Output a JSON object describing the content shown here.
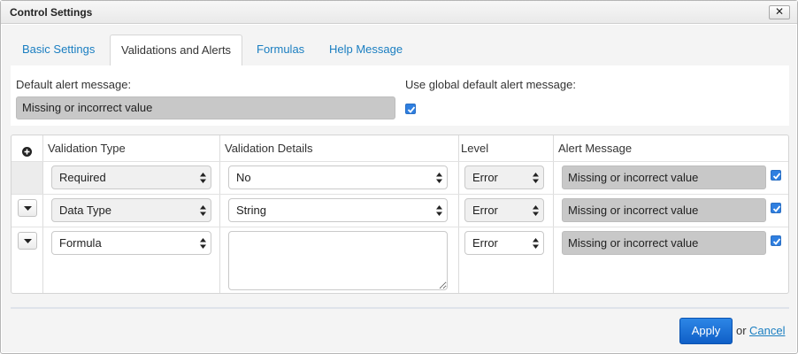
{
  "window": {
    "title": "Control Settings",
    "close_label": "✕"
  },
  "tabs": [
    {
      "label": "Basic Settings",
      "active": false
    },
    {
      "label": "Validations and Alerts",
      "active": true
    },
    {
      "label": "Formulas",
      "active": false
    },
    {
      "label": "Help Message",
      "active": false
    }
  ],
  "defaults": {
    "alert_label": "Default alert message:",
    "alert_value": "Missing or incorrect value",
    "global_label": "Use global default alert message:",
    "global_checked": true
  },
  "grid": {
    "headers": [
      "Validation Type",
      "Validation Details",
      "Level",
      "Alert Message"
    ],
    "rows": [
      {
        "type": "Required",
        "details": "No",
        "details_kind": "select",
        "level": "Error",
        "alert": "Missing or incorrect value",
        "checked": true
      },
      {
        "type": "Data Type",
        "details": "String",
        "details_kind": "select",
        "level": "Error",
        "alert": "Missing or incorrect value",
        "checked": true
      },
      {
        "type": "Formula",
        "details": "",
        "details_kind": "textarea",
        "level": "Error",
        "alert": "Missing or incorrect value",
        "checked": true
      }
    ]
  },
  "footer": {
    "apply_label": "Apply",
    "or_text": "or",
    "cancel_label": "Cancel"
  },
  "colors": {
    "accent": "#1a7ec1",
    "primary_button": "#1d6fd6",
    "checkbox": "#2f7fe0"
  }
}
